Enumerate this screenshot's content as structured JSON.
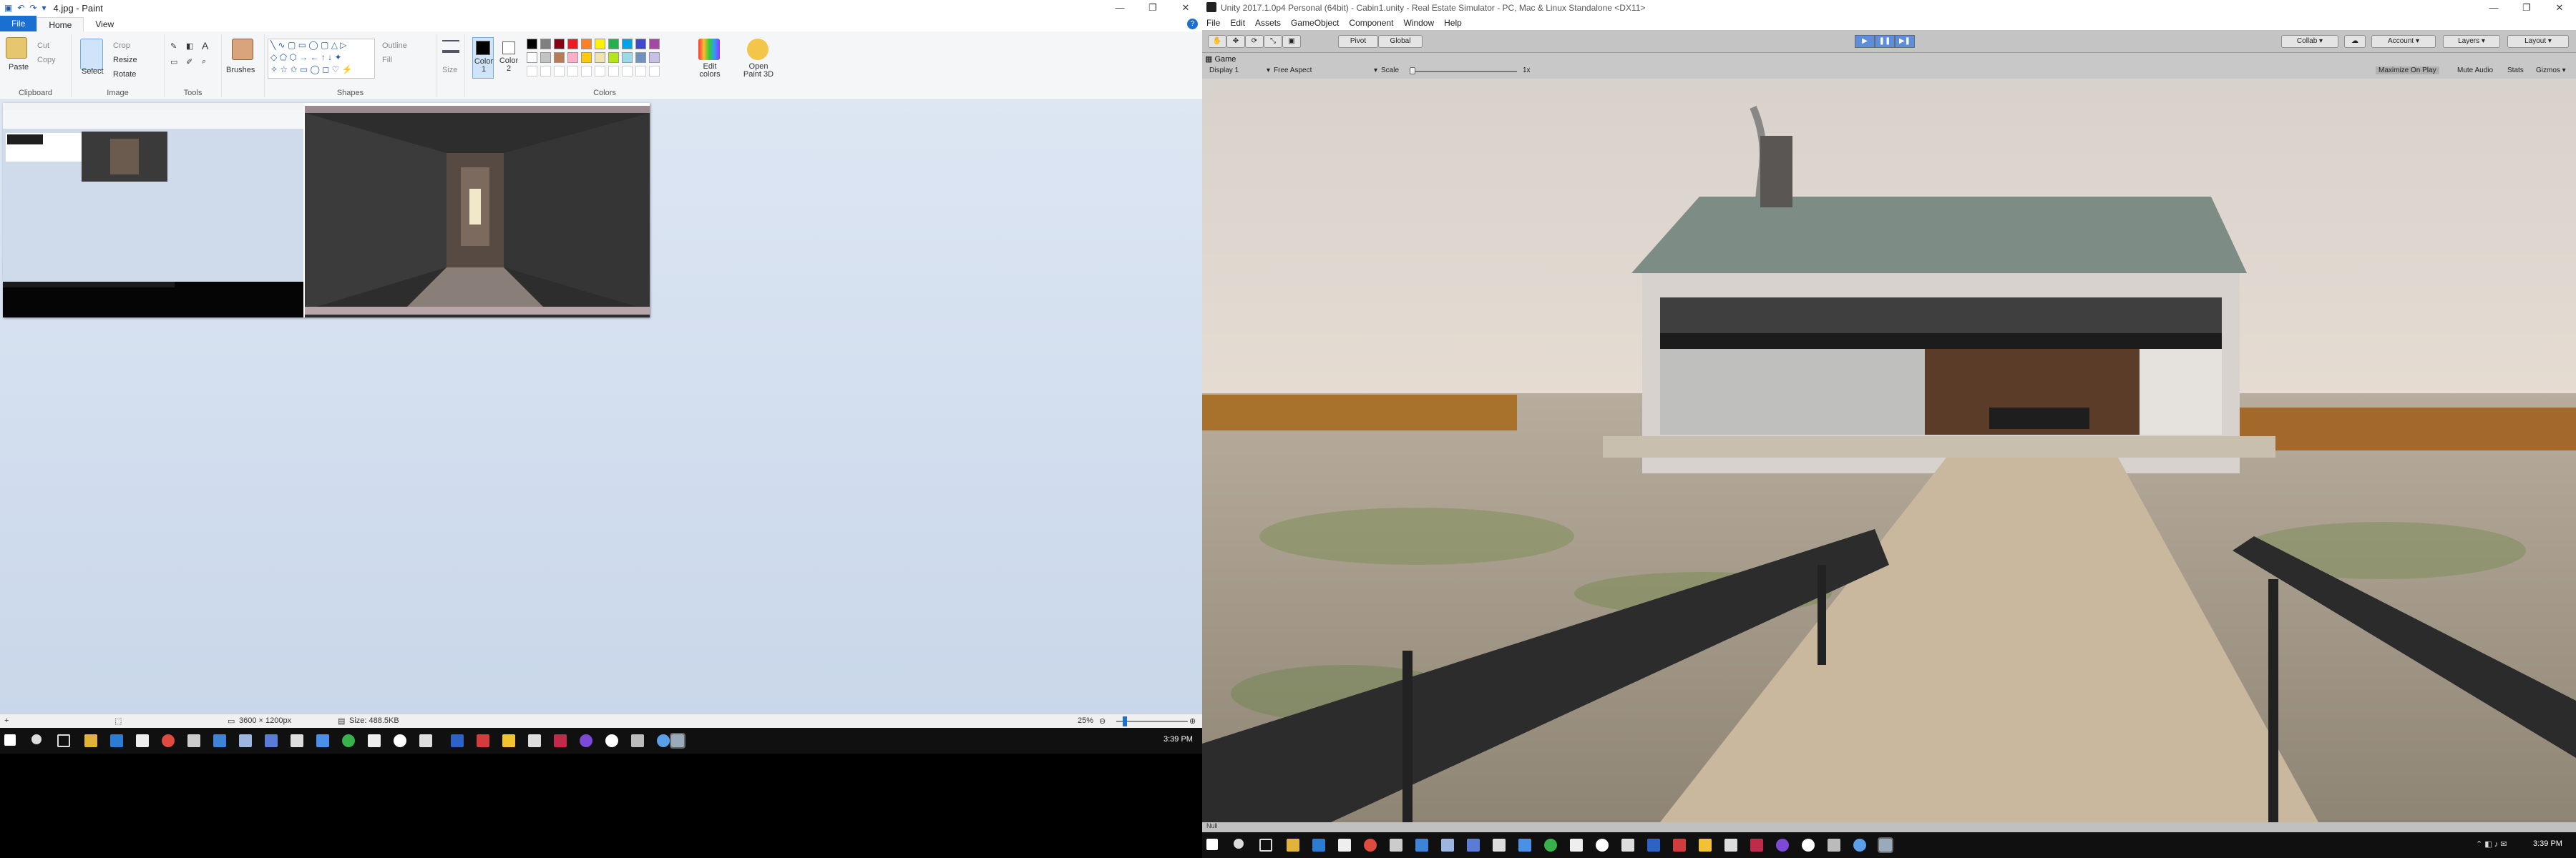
{
  "paint": {
    "window_title": "4.jpg - Paint",
    "tabs": {
      "file": "File",
      "home": "Home",
      "view": "View"
    },
    "clipboard": {
      "paste": "Paste",
      "cut": "Cut",
      "copy": "Copy",
      "group_label": "Clipboard"
    },
    "image": {
      "select": "Select",
      "crop": "Crop",
      "resize": "Resize",
      "rotate": "Rotate",
      "group_label": "Image"
    },
    "tools": {
      "group_label": "Tools"
    },
    "brushes": {
      "label": "Brushes"
    },
    "shapes": {
      "outline": "Outline",
      "fill": "Fill",
      "group_label": "Shapes"
    },
    "size": {
      "label": "Size"
    },
    "colors": {
      "color1": "Color 1",
      "color2": "Color 2",
      "edit_colors": "Edit colors",
      "group_label": "Colors",
      "palette_row1": [
        "#000000",
        "#7f7f7f",
        "#880015",
        "#ed1c24",
        "#ff7f27",
        "#fff200",
        "#22b14c",
        "#00a2e8",
        "#3f48cc",
        "#a349a4"
      ],
      "palette_row2": [
        "#ffffff",
        "#c3c3c3",
        "#b97a57",
        "#ffaec9",
        "#ffc90e",
        "#efe4b0",
        "#b5e61d",
        "#99d9ea",
        "#7092be",
        "#c8bfe7"
      ]
    },
    "paint3d": {
      "label": "Open Paint 3D"
    },
    "status": {
      "dimensions": "3600 × 1200px",
      "size": "Size: 488.5KB",
      "zoom": "25%"
    },
    "zoom_level": 0.1
  },
  "taskbar_left": {
    "clock": "3:39 PM"
  },
  "unity": {
    "window_title": "Unity 2017.1.0p4 Personal (64bit) - Cabin1.unity - Real Estate Simulator - PC, Mac & Linux Standalone <DX11>",
    "menu": [
      "File",
      "Edit",
      "Assets",
      "GameObject",
      "Component",
      "Window",
      "Help"
    ],
    "toolbar": {
      "pivot": "Pivot",
      "global": "Global",
      "collab": "Collab ▾",
      "account": "Account ▾",
      "layers": "Layers ▾",
      "layout": "Layout ▾"
    },
    "game_view": {
      "tab": "Game",
      "display": "Display 1",
      "aspect": "Free Aspect",
      "scale_label": "Scale",
      "scale_value": "1x",
      "maximize": "Maximize On Play",
      "mute": "Mute Audio",
      "stats": "Stats",
      "gizmos": "Gizmos ▾"
    },
    "status_text": "Null"
  },
  "taskbar_right": {
    "clock": "3:39 PM"
  }
}
